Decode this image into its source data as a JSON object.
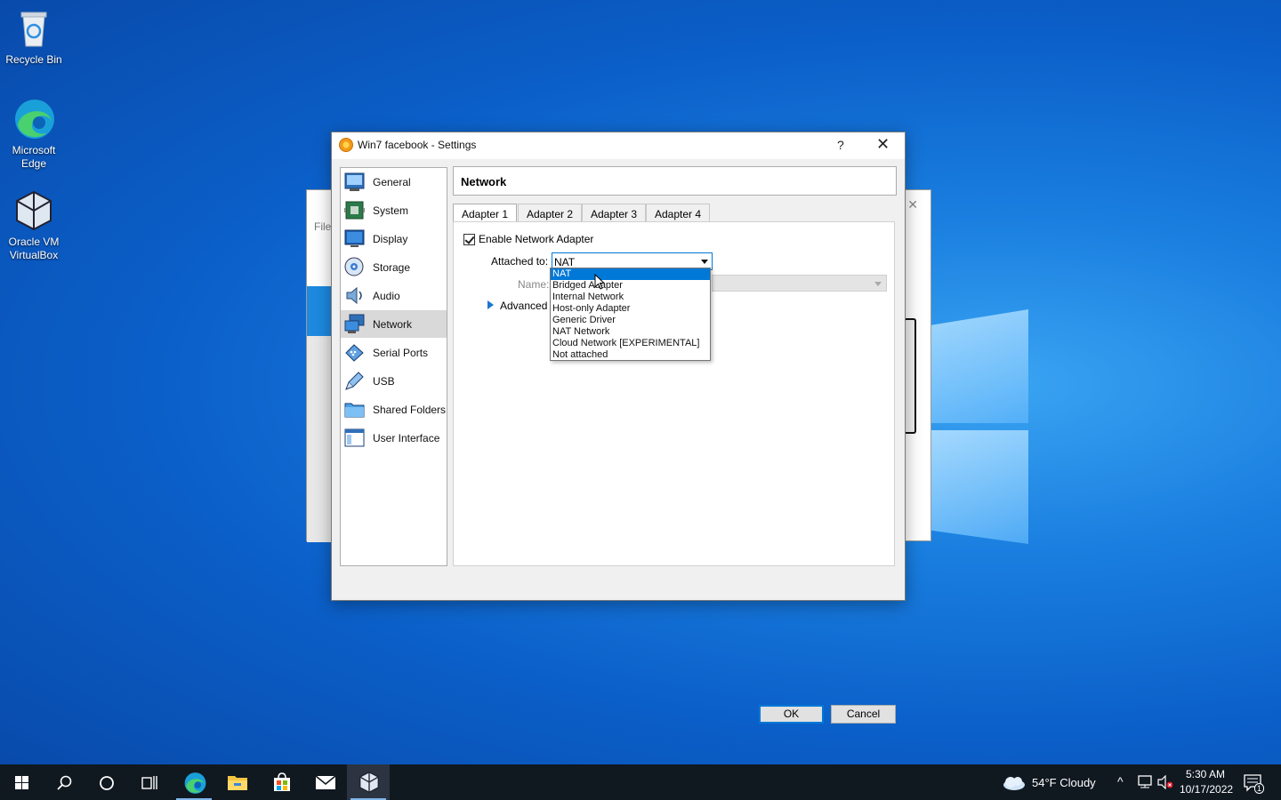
{
  "desktop": {
    "icons": [
      {
        "label": "Recycle Bin"
      },
      {
        "label": "Microsoft Edge"
      },
      {
        "label": "Oracle VM VirtualBox"
      }
    ]
  },
  "background_window": {
    "menu_text": "File"
  },
  "dialog": {
    "title": "Win7 facebook - Settings",
    "help": "?",
    "close": "✕",
    "sidebar": [
      {
        "label": "General",
        "icon": "general-icon"
      },
      {
        "label": "System",
        "icon": "system-icon"
      },
      {
        "label": "Display",
        "icon": "display-icon"
      },
      {
        "label": "Storage",
        "icon": "storage-icon"
      },
      {
        "label": "Audio",
        "icon": "audio-icon"
      },
      {
        "label": "Network",
        "icon": "network-icon",
        "selected": true
      },
      {
        "label": "Serial Ports",
        "icon": "serial-ports-icon"
      },
      {
        "label": "USB",
        "icon": "usb-icon"
      },
      {
        "label": "Shared Folders",
        "icon": "shared-folders-icon"
      },
      {
        "label": "User Interface",
        "icon": "user-interface-icon"
      }
    ],
    "section_title": "Network",
    "tabs": [
      {
        "label": "Adapter 1",
        "active": true
      },
      {
        "label": "Adapter 2"
      },
      {
        "label": "Adapter 3"
      },
      {
        "label": "Adapter 4"
      }
    ],
    "enable_adapter_label": "Enable Network Adapter",
    "enable_adapter_checked": true,
    "attached_to_label": "Attached to:",
    "attached_to_value": "NAT",
    "name_label": "Name:",
    "advanced_label": "Advanced",
    "attached_options": [
      "NAT",
      "Bridged Adapter",
      "Internal Network",
      "Host-only Adapter",
      "Generic Driver",
      "NAT Network",
      "Cloud Network [EXPERIMENTAL]",
      "Not attached"
    ],
    "ok_label": "OK",
    "cancel_label": "Cancel"
  },
  "taskbar": {
    "weather": "54°F  Cloudy",
    "time": "5:30 AM",
    "date": "10/17/2022",
    "notification_count": "1"
  },
  "colors": {
    "accent": "#0078d7",
    "selected_item": "#d9d9d9",
    "taskbar": "#101820"
  }
}
